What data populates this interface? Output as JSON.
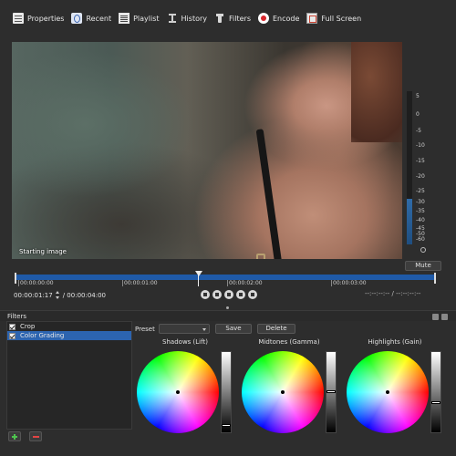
{
  "toolbar": {
    "items": [
      {
        "label": "Properties",
        "icon": "properties-icon"
      },
      {
        "label": "Recent",
        "icon": "recent-icon"
      },
      {
        "label": "Playlist",
        "icon": "playlist-icon"
      },
      {
        "label": "History",
        "icon": "history-icon"
      },
      {
        "label": "Filters",
        "icon": "filters-icon"
      },
      {
        "label": "Encode",
        "icon": "encode-icon"
      },
      {
        "label": "Full Screen",
        "icon": "full-screen-icon"
      }
    ]
  },
  "video": {
    "label": "Starting image"
  },
  "meter": {
    "ticks": [
      "5",
      "0",
      "-5",
      "-10",
      "-15",
      "-20",
      "-25",
      "-30",
      "-35",
      "-40",
      "-45",
      "-50",
      "-60"
    ],
    "mute_label": "Mute"
  },
  "timeline": {
    "ruler_labels": [
      "00:00:00:00",
      "00:00:01:00",
      "00:00:02:00",
      "00:00:03:00"
    ],
    "current_time": "00:00:01:17",
    "total_time": "/ 00:00:04:00",
    "in_out": "--:--:--:-- / --:--:--:--"
  },
  "filters": {
    "title": "Filters",
    "items": [
      {
        "label": "Crop",
        "checked": true,
        "selected": false
      },
      {
        "label": "Color Grading",
        "checked": true,
        "selected": true
      }
    ],
    "preset_label": "Preset",
    "preset_value": "",
    "save_label": "Save",
    "delete_label": "Delete",
    "wheels": [
      {
        "label": "Shadows (Lift)",
        "slider_level": 0.05
      },
      {
        "label": "Midtones (Gamma)",
        "slider_level": 0.5
      },
      {
        "label": "Highlights (Gain)",
        "slider_level": 0.35
      }
    ]
  },
  "colors": {
    "accent": "#2c64b0",
    "timeline_track": "#1f5aa8",
    "background": "#2d2d2d"
  }
}
